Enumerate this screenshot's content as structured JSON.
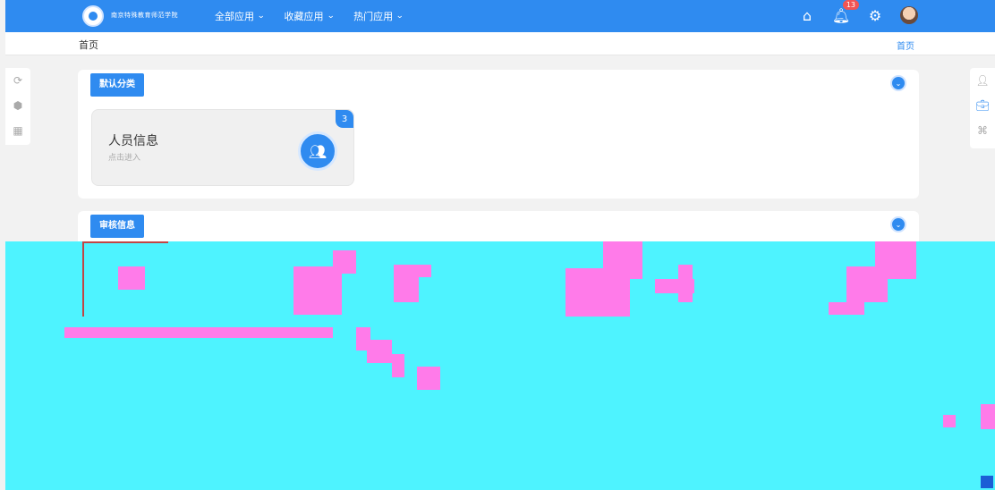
{
  "topbar": {
    "school": "南京特殊教育师范学院",
    "nav": [
      {
        "label": "全部应用"
      },
      {
        "label": "收藏应用"
      },
      {
        "label": "热门应用"
      }
    ],
    "icons": [
      "home-icon",
      "bell-icon",
      "settings-icon",
      "avatar"
    ],
    "notification_count": "13",
    "accent": "#2f8bf0"
  },
  "breadcrumb": {
    "left": "首页",
    "right": "首页"
  },
  "sections": [
    {
      "tag": "默认分类",
      "apps": [
        {
          "title": "人员信息",
          "subtitle": "点击进入",
          "count": "3",
          "icon": "people-icon"
        }
      ]
    },
    {
      "tag": "审核信息"
    }
  ],
  "left_sidebar": [
    "refresh-icon",
    "settings-icon",
    "grid-icon"
  ],
  "right_sidebar": [
    "users-icon",
    "briefcase-icon",
    "org-icon"
  ]
}
